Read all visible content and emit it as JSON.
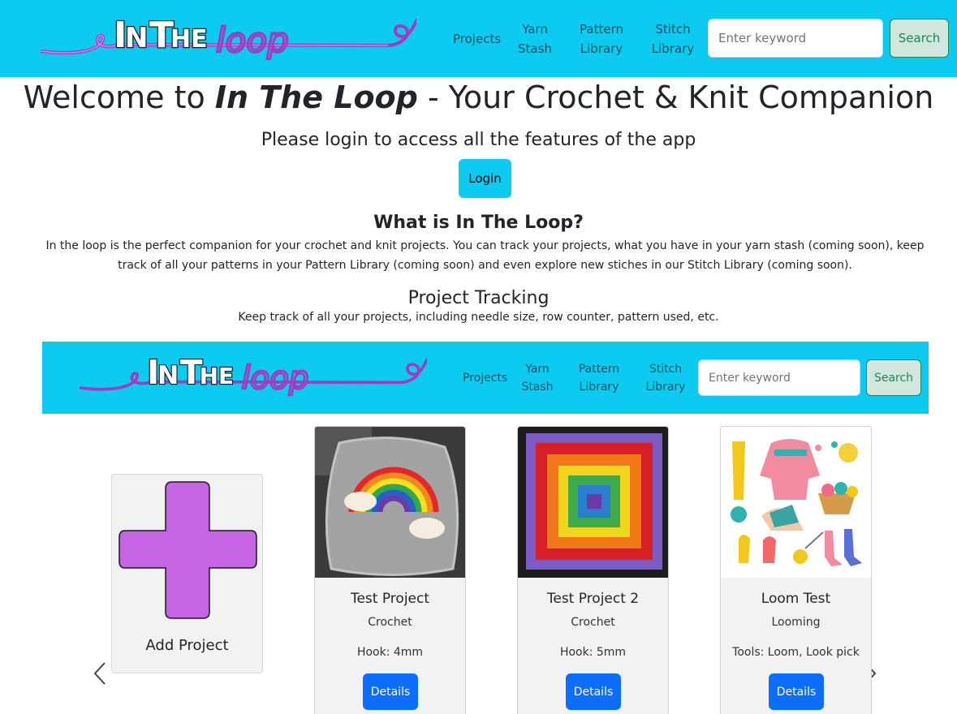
{
  "brand": {
    "logo_text": "InTheloop",
    "accent": "#0dcaf0"
  },
  "nav": {
    "projects": "Projects",
    "yarn_stash_1": "Yarn",
    "yarn_stash_2": "Stash",
    "pattern_library_1": "Pattern",
    "pattern_library_2": "Library",
    "stitch_library_1": "Stitch",
    "stitch_library_2": "Library",
    "search_placeholder": "Enter keyword",
    "search_label": "Search"
  },
  "hero": {
    "welcome_prefix": "Welcome to ",
    "welcome_brand": "In The Loop",
    "welcome_suffix": " - Your Crochet & Knit Companion",
    "subtitle": "Please login to access all the features of the app",
    "login_label": "Login"
  },
  "about": {
    "title": "What is In The Loop?",
    "body": "In the loop is the perfect companion for your crochet and knit projects. You can track your projects, what you have in your yarn stash (coming soon), keep track of all your patterns in your Pattern Library (coming soon) and even explore new stiches in our Stitch Library (coming soon)."
  },
  "tracking": {
    "title": "Project Tracking",
    "body": "Keep track of all your projects, including needle size, row counter, pattern used, etc."
  },
  "carousel": {
    "add_label": "Add Project",
    "projects": [
      {
        "title": "Test Project",
        "type": "Crochet",
        "tool": "Hook: 4mm",
        "details_label": "Details"
      },
      {
        "title": "Test Project 2",
        "type": "Crochet",
        "tool": "Hook: 5mm",
        "details_label": "Details"
      },
      {
        "title": "Loom Test",
        "type": "Looming",
        "tool": "Tools: Loom, Look pick",
        "details_label": "Details"
      }
    ],
    "prev_icon": "chevron-left-icon",
    "next_icon": "chevron-right-icon"
  }
}
